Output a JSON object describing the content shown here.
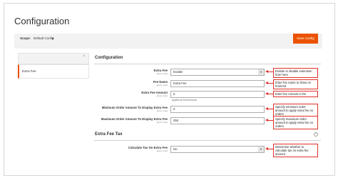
{
  "header": {
    "title": "Configuration"
  },
  "scope": {
    "label": "Scope:",
    "value": "Default Config",
    "caret": "▼"
  },
  "toolbar": {
    "save_label": "Save Config"
  },
  "sidebar": {
    "caret": "⌃",
    "items": [
      {
        "label": "Extra Fee"
      }
    ]
  },
  "sections": {
    "configuration": {
      "title": "Configuration",
      "toggle": "⌃"
    },
    "extra_fee_tax": {
      "title": "Extra Fee Tax",
      "toggle": "⌃"
    }
  },
  "fields": {
    "extra_fee": {
      "label": "Extra Fee",
      "scope": "[store view]",
      "value": "Enable",
      "caret": "▾"
    },
    "fee_name": {
      "label": "Fee Name",
      "scope": "[store view]",
      "value": "Extra Fee"
    },
    "fee_amount": {
      "label": "Extra Fee Amount",
      "scope": "[store view]",
      "value": "5",
      "hint": "Applies as Fixed Amount"
    },
    "min_amount": {
      "label": "Minimum Order Amount To Display Extra Fee",
      "scope": "[store view]",
      "value": "0"
    },
    "max_amount": {
      "label": "Maximum Order Amount To Display Extra Fee",
      "scope": "[store view]",
      "value": "250"
    },
    "calc_tax": {
      "label": "Calculate Tax On Extra Fee",
      "scope": "[store view]",
      "value": "No",
      "caret": "▾"
    }
  },
  "callouts": {
    "extra_fee": "Enable or disable extension from here",
    "fee_name": "Enter fee name to show on frontend",
    "fee_amount": "Enter fee Amount in Rs",
    "min_amount": "Specify minimum order amount to apply extra fee on orders",
    "max_amount": "Specify maximum order amount to apply extra fee on orders",
    "calc_tax": "Determine whether to calculate tax on extra fee amount"
  },
  "colors": {
    "accent": "#eb5202",
    "annotation": "#e03127",
    "panel": "#f2f2f2"
  }
}
